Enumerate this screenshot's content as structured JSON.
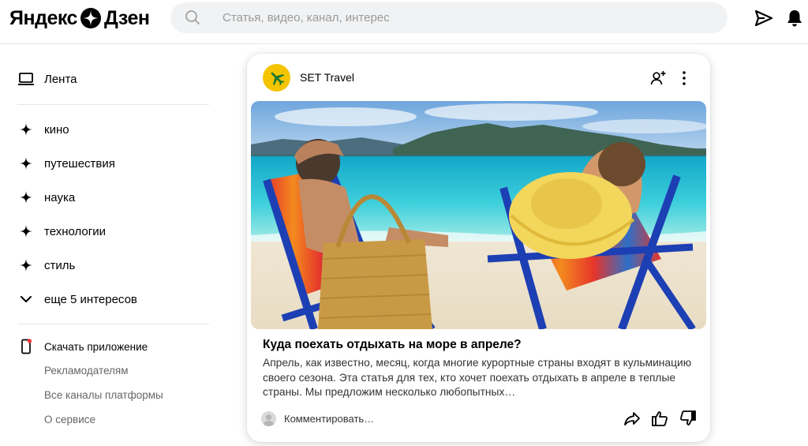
{
  "header": {
    "logo_left": "Яндекс",
    "logo_right": "Дзен",
    "search_placeholder": "Статья, видео, канал, интерес",
    "icons": [
      "search-icon",
      "send-icon",
      "bell-icon"
    ]
  },
  "sidebar": {
    "feed_label": "Лента",
    "interests": [
      {
        "label": "кино",
        "icon": "sparkle-icon"
      },
      {
        "label": "путешествия",
        "icon": "sparkle-icon"
      },
      {
        "label": "наука",
        "icon": "sparkle-icon"
      },
      {
        "label": "технологии",
        "icon": "sparkle-icon"
      },
      {
        "label": "стиль",
        "icon": "sparkle-icon"
      }
    ],
    "more_label": "еще 5 интересов",
    "app_label": "Скачать приложение",
    "links": [
      "Рекламодателям",
      "Все каналы платформы",
      "О сервисе"
    ]
  },
  "card": {
    "channel_name": "SET Travel",
    "title": "Куда поехать отдыхать на море в апреле?",
    "snippet": "Апрель, как известно, месяц, когда многие курортные страны входят в кульминацию своего сезона. Эта статья для тех, кто хочет поехать отдыхать в апреле в теплые страны. Мы предложим несколько любопытных…",
    "comment_label": "Комментировать…"
  },
  "colors": {
    "accent_avatar": "#f5c400",
    "search_bg": "#f1f2f3",
    "divider": "#e6e6e6",
    "secondary_text": "#666666"
  }
}
